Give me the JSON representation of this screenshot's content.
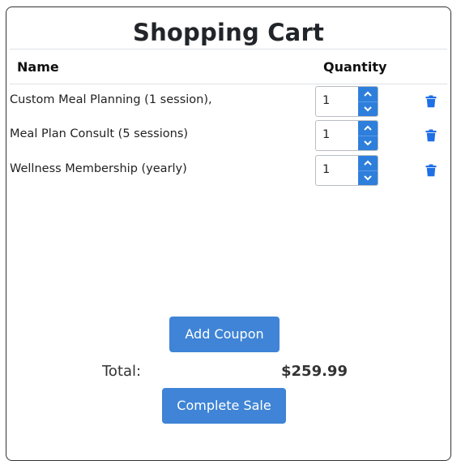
{
  "cart": {
    "title": "Shopping Cart",
    "columns": {
      "name": "Name",
      "quantity": "Quantity"
    },
    "items": [
      {
        "name": "Custom Meal Planning (1 session),",
        "quantity": "1"
      },
      {
        "name": "Meal Plan Consult (5 sessions)",
        "quantity": "1"
      },
      {
        "name": "Wellness Membership (yearly)",
        "quantity": "1"
      }
    ],
    "add_coupon_label": "Add Coupon",
    "total_label": "Total:",
    "total_value": "$259.99",
    "complete_sale_label": "Complete Sale"
  },
  "icons": {
    "remove": "trash-icon",
    "increment": "chevron-up-icon",
    "decrement": "chevron-down-icon"
  },
  "colors": {
    "accent": "#3f84d6",
    "stepper": "#2e7fdc",
    "trash": "#1f6fe5"
  }
}
